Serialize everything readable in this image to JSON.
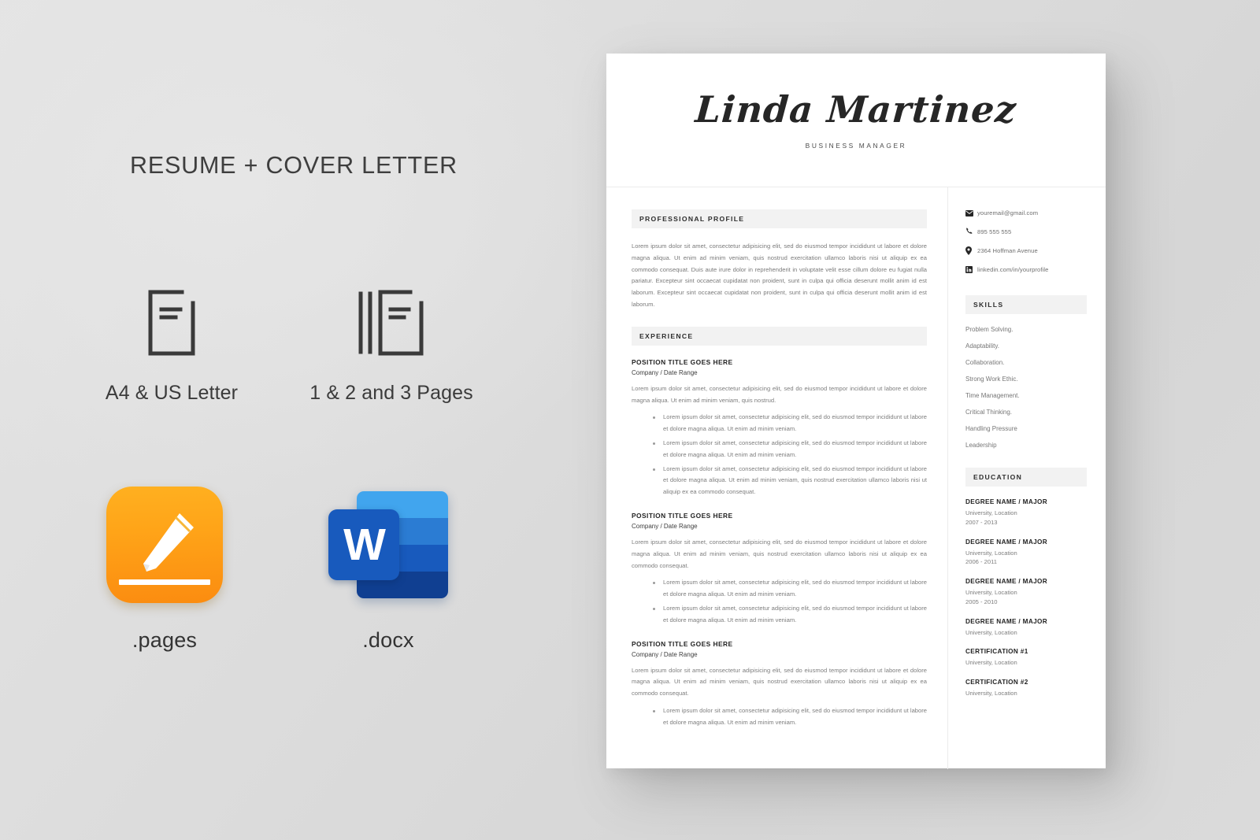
{
  "promo": {
    "title": "RESUME + COVER LETTER",
    "features": [
      {
        "icon": "single-page-document-icon",
        "label": "A4 & US Letter"
      },
      {
        "icon": "multi-page-document-icon",
        "label": "1 & 2 and 3 Pages"
      }
    ],
    "formats": [
      {
        "icon": "apple-pages-app-icon",
        "label": ".pages"
      },
      {
        "icon": "microsoft-word-app-icon",
        "label": ".docx"
      }
    ]
  },
  "resume": {
    "header": {
      "name": "Linda Martinez",
      "role": "BUSINESS MANAGER"
    },
    "profile": {
      "heading": "PROFESSIONAL PROFILE",
      "text": "Lorem ipsum dolor sit amet, consectetur adipisicing elit, sed do eiusmod tempor incididunt ut labore et dolore magna aliqua. Ut enim ad minim veniam, quis nostrud exercitation ullamco laboris nisi ut aliquip ex ea commodo consequat. Duis aute irure dolor in reprehenderit in voluptate velit esse cillum dolore eu fugiat nulla pariatur. Excepteur sint occaecat cupidatat non proident, sunt in culpa qui officia deserunt mollit anim id est laborum. Excepteur sint occaecat cupidatat non proident, sunt in culpa qui officia deserunt mollit anim id est laborum."
    },
    "experience": {
      "heading": "EXPERIENCE",
      "jobs": [
        {
          "title": "POSITION TITLE GOES HERE",
          "meta": "Company / Date Range",
          "desc": "Lorem ipsum dolor sit amet, consectetur adipisicing elit, sed do eiusmod tempor incididunt ut labore et dolore magna aliqua. Ut enim ad minim veniam, quis nostrud.",
          "bullets": [
            "Lorem ipsum dolor sit amet, consectetur adipisicing elit, sed do eiusmod tempor incididunt ut labore et dolore magna aliqua. Ut enim ad minim veniam.",
            "Lorem ipsum dolor sit amet, consectetur adipisicing elit, sed do eiusmod tempor incididunt ut labore et dolore magna aliqua. Ut enim ad minim veniam.",
            "Lorem ipsum dolor sit amet, consectetur adipisicing elit, sed do eiusmod tempor incididunt ut labore et dolore magna aliqua. Ut enim ad minim veniam, quis nostrud exercitation ullamco laboris nisi ut aliquip ex ea commodo consequat."
          ]
        },
        {
          "title": "POSITION TITLE GOES HERE",
          "meta": "Company / Date Range",
          "desc": "Lorem ipsum dolor sit amet, consectetur adipisicing elit, sed do eiusmod tempor incididunt ut labore et dolore magna aliqua. Ut enim ad minim veniam, quis nostrud exercitation ullamco laboris nisi ut aliquip ex ea commodo consequat.",
          "bullets": [
            "Lorem ipsum dolor sit amet, consectetur adipisicing elit, sed do eiusmod tempor incididunt ut labore et dolore magna aliqua. Ut enim ad minim veniam.",
            "Lorem ipsum dolor sit amet, consectetur adipisicing elit, sed do eiusmod tempor incididunt ut labore et dolore magna aliqua. Ut enim ad minim veniam."
          ]
        },
        {
          "title": "POSITION TITLE GOES HERE",
          "meta": "Company / Date Range",
          "desc": "Lorem ipsum dolor sit amet, consectetur adipisicing elit, sed do eiusmod tempor incididunt ut labore et dolore magna aliqua. Ut enim ad minim veniam, quis nostrud exercitation ullamco laboris nisi ut aliquip ex ea commodo consequat.",
          "bullets": [
            "Lorem ipsum dolor sit amet, consectetur adipisicing elit, sed do eiusmod tempor incididunt ut labore et dolore magna aliqua. Ut enim ad minim veniam."
          ]
        }
      ]
    },
    "contact": [
      {
        "icon": "envelope-icon",
        "value": "youremail@gmail.com"
      },
      {
        "icon": "phone-icon",
        "value": "895 555 555"
      },
      {
        "icon": "location-pin-icon",
        "value": "2364 Hoffman Avenue"
      },
      {
        "icon": "linkedin-icon",
        "value": "linkedin.com/in/yourprofile"
      }
    ],
    "skills": {
      "heading": "SKILLS",
      "items": [
        "Problem Solving.",
        "Adaptability.",
        "Collaboration.",
        "Strong Work Ethic.",
        "Time Management.",
        "Critical Thinking.",
        "Handling Pressure",
        "Leadership"
      ]
    },
    "education": {
      "heading": "EDUCATION",
      "items": [
        {
          "degree": "DEGREE NAME / MAJOR",
          "where": "University, Location",
          "years": "2007 - 2013"
        },
        {
          "degree": "DEGREE NAME / MAJOR",
          "where": "University, Location",
          "years": "2006 - 2011"
        },
        {
          "degree": "DEGREE NAME / MAJOR",
          "where": "University, Location",
          "years": "2005 - 2010"
        },
        {
          "degree": "DEGREE NAME / MAJOR",
          "where": "University, Location",
          "years": ""
        },
        {
          "degree": "CERTIFICATION #1",
          "where": "University, Location",
          "years": ""
        },
        {
          "degree": "CERTIFICATION #2",
          "where": "University, Location",
          "years": ""
        }
      ]
    }
  },
  "colors": {
    "background": "#dcdcdc",
    "paper": "#ffffff",
    "section_band": "#f2f2f2",
    "body_text": "#7a7a7a",
    "heading_text": "#232323",
    "pages_orange": "#ffa418",
    "word_blue": "#185abd"
  }
}
